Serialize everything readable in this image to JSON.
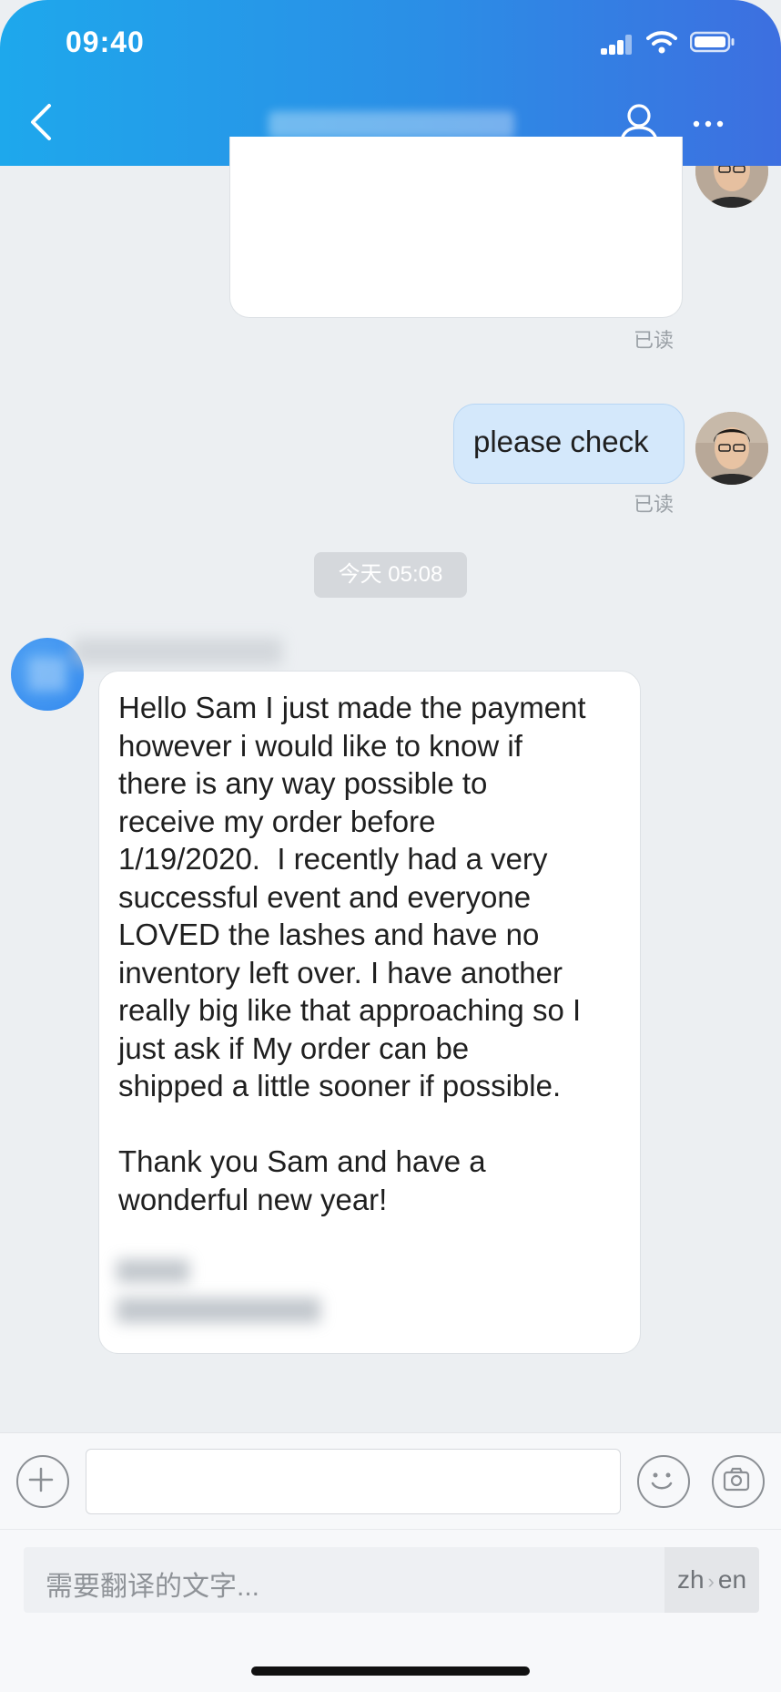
{
  "status_bar": {
    "time": "09:40"
  },
  "header": {
    "back_icon": "chevron-left-icon",
    "contact_icon": "person-icon",
    "more_icon": "more-dots-icon"
  },
  "messages": [
    {
      "side": "right",
      "type": "card",
      "read_status": "已读"
    },
    {
      "side": "right",
      "type": "text",
      "text": "please check",
      "read_status": "已读"
    },
    {
      "type": "timestamp",
      "text": "今天 05:08"
    },
    {
      "side": "left",
      "type": "text",
      "text": "Hello Sam I just made the payment\nhowever i would like to know if\nthere is any way possible to\nreceive my order before\n1/19/2020.  I recently had a very\nsuccessful event and everyone\nLOVED the lashes and have no\ninventory left over. I have another\nreally big like that approaching so I\njust ask if My order can be\nshipped a little sooner if possible.\n\nThank you Sam and have a\nwonderful new year!"
    }
  ],
  "input_bar": {
    "add_icon": "plus-icon",
    "emoji_icon": "smiley-icon",
    "camera_icon": "camera-icon"
  },
  "translate": {
    "placeholder": "需要翻译的文字...",
    "from": "zh",
    "to": "en"
  },
  "colors": {
    "header_start": "#1ea8ec",
    "header_end": "#3d6fe0",
    "own_bubble": "#d4e8fb",
    "background": "#eceff2"
  }
}
